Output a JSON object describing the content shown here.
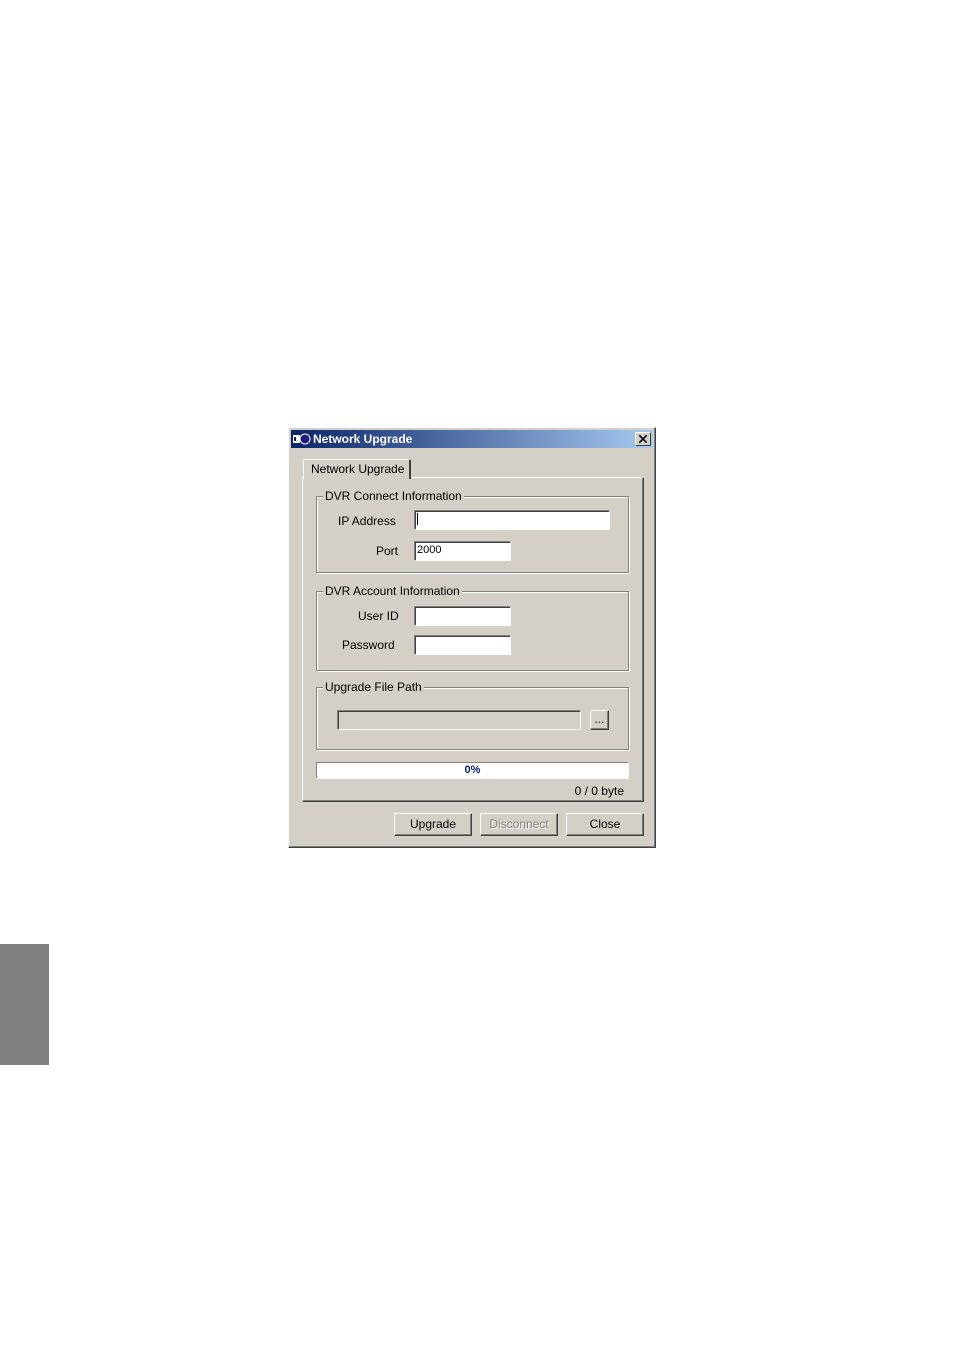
{
  "window": {
    "title": "Network Upgrade",
    "title_bar_color": "#0a246a",
    "face_color": "#d4d0c8"
  },
  "tabs": [
    {
      "label": "Network Upgrade",
      "selected": true
    }
  ],
  "connect_group": {
    "title": "DVR Connect Information",
    "ip_label": "IP Address",
    "ip_value": "",
    "port_label": "Port",
    "port_value": "2000"
  },
  "account_group": {
    "title": "DVR Account Information",
    "userid_label": "User ID",
    "userid_value": "",
    "password_label": "Password",
    "password_value": ""
  },
  "file_group": {
    "title": "Upgrade File Path",
    "path_value": "",
    "browse_label": "..."
  },
  "progress": {
    "percent": 0,
    "percent_text": "0%",
    "bytes_text": "0 / 0 byte"
  },
  "buttons": {
    "upgrade": "Upgrade",
    "disconnect": "Disconnect",
    "close": "Close"
  }
}
